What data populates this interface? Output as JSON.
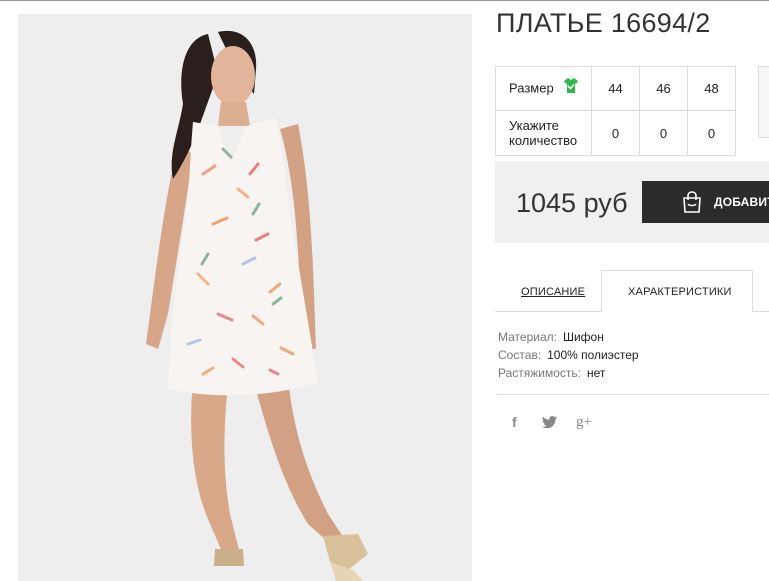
{
  "product": {
    "title": "ПЛАТЬЕ 16694/2",
    "price": "1045 руб",
    "buy_label": "ДОБАВИТЬ"
  },
  "size_table": {
    "size_label": "Размер",
    "qty_label_line1": "Укажите",
    "qty_label_line2": "количество",
    "sizes": [
      "44",
      "46",
      "48"
    ],
    "quantities": [
      "0",
      "0",
      "0"
    ]
  },
  "tabs": {
    "description": "ОПИСАНИЕ",
    "specs": "ХАРАКТЕРИСТИКИ"
  },
  "specs": [
    {
      "key": "Материал:",
      "value": "Шифон"
    },
    {
      "key": "Состав:",
      "value": "100% полиэстер"
    },
    {
      "key": "Растяжимость:",
      "value": "нет"
    }
  ],
  "social": {
    "facebook": "f",
    "twitter": "twitter-icon",
    "googleplus": "g+"
  },
  "colors": {
    "accent_green": "#2db84b",
    "button_dark": "#2b2b2b",
    "panel_gray": "#f0f0f0"
  }
}
